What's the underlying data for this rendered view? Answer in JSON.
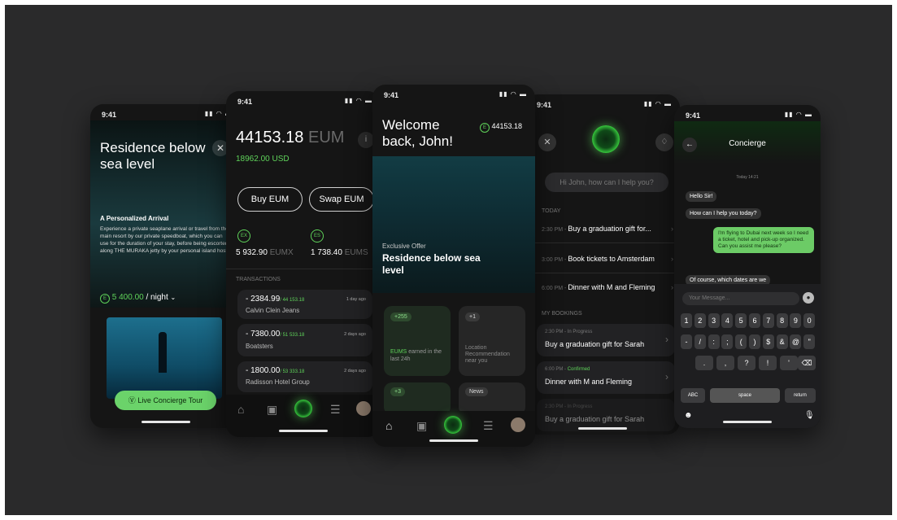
{
  "colors": {
    "accent": "#5fd35a",
    "background": "#2a2a2b",
    "phone": "#151515"
  },
  "status": {
    "time": "9:41"
  },
  "phone1": {
    "title": "Residence below sea level",
    "close_icon": "close-icon",
    "arrival_title": "A Personalized Arrival",
    "arrival_text": "Experience a private seaplane arrival or travel from the main resort by our private speedboat, which you can use for the duration of your stay, before being escorted along THE MURAKA jetty by your personal island host.",
    "price": "5 400.00",
    "price_unit": "/ night",
    "tour_button": "Live Concierge Tour"
  },
  "phone2": {
    "balance": "44153.18",
    "balance_unit": "EUM",
    "usd": "18962.00",
    "usd_unit": "USD",
    "info": "i",
    "buy_button": "Buy EUM",
    "swap_button": "Swap EUM",
    "token1": {
      "icon": "EX",
      "value": "5 932.90",
      "unit": "EUMX"
    },
    "token2": {
      "icon": "ES",
      "value": "1 738.40",
      "unit": "EUMS"
    },
    "transactions_title": "TRANSACTIONS",
    "transactions": [
      {
        "amount": "- 2384.99",
        "sub": "/ 44 153.18",
        "time": "1 day ago",
        "name": "Calvin Clein Jeans"
      },
      {
        "amount": "- 7380.00",
        "sub": "/ 51 533.18",
        "time": "2 days ago",
        "name": "Boatsters"
      },
      {
        "amount": "- 1800.00",
        "sub": "/ 53 333.18",
        "time": "2 days ago",
        "name": "Radisson Hotel Group"
      }
    ]
  },
  "phone3": {
    "welcome_line1": "Welcome",
    "welcome_line2": "back, John!",
    "balance_badge": "44153.18",
    "offer_label": "Exclusive Offer",
    "offer_title": "Residence below sea level",
    "tile1_badge": "+255",
    "tile1_text_green": "EUMS",
    "tile1_text": "earned in the last 24h",
    "tile2_badge": "+1",
    "tile2_text": "Location Recommendation near you",
    "tile3_badge": "+3",
    "tile4_badge": "News"
  },
  "phone4": {
    "prompt": "Hi John, how can I help you?",
    "today_label": "TODAY",
    "today_items": [
      {
        "time": "2:30 PM",
        "text": "Buy a graduation gift for..."
      },
      {
        "time": "3:00 PM",
        "text": "Book tickets to Amsterdam"
      },
      {
        "time": "6:00 PM",
        "text": "Dinner with M and Fleming"
      }
    ],
    "bookings_label": "MY BOOKINGS",
    "bookings": [
      {
        "time": "2:30 PM",
        "status": "In Progress",
        "title": "Buy a graduation gift for Sarah"
      },
      {
        "time": "6:00 PM",
        "status": "Confirmed",
        "title": "Dinner with M and Fleming"
      },
      {
        "time": "2:30 PM",
        "status": "In Progress",
        "title": "Buy a graduation gift for Sarah"
      }
    ]
  },
  "phone5": {
    "title": "Concierge",
    "date": "Today 14:21",
    "messages": [
      {
        "from": "agent",
        "text": "Hello Sir!"
      },
      {
        "from": "agent",
        "text": "How can I help you today?"
      },
      {
        "from": "user",
        "text": "I'm flying to Dubai next week so I need a ticket, hotel and pick-up organized. Can you assist me please?"
      },
      {
        "from": "agent",
        "text": "Of course, which dates are we"
      }
    ],
    "input_placeholder": "Your Message...",
    "keys_row1": [
      "1",
      "2",
      "3",
      "4",
      "5",
      "6",
      "7",
      "8",
      "9",
      "0"
    ],
    "keys_row2": [
      "-",
      "/",
      ":",
      ";",
      "(",
      ")",
      "$",
      "&",
      "@",
      "\""
    ],
    "keys_row3": [
      ".",
      ",",
      "?",
      "!",
      "'"
    ],
    "key_abc": "ABC",
    "key_space": "space",
    "key_return": "return"
  }
}
